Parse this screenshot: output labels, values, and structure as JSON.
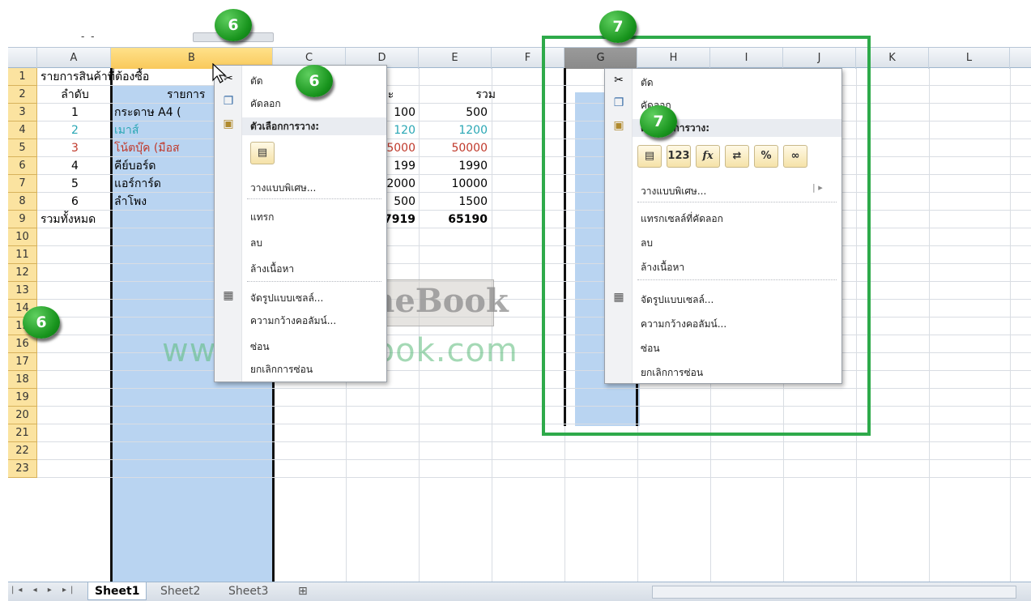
{
  "formula_bar": {
    "name_box_fragment": "- -"
  },
  "columns": [
    "A",
    "B",
    "C",
    "D",
    "E",
    "F",
    "G",
    "H",
    "I",
    "J",
    "K",
    "L"
  ],
  "rows": [
    "1",
    "2",
    "3",
    "4",
    "5",
    "6",
    "7",
    "8",
    "9",
    "10",
    "11",
    "12",
    "13",
    "14",
    "15",
    "16",
    "17",
    "18",
    "19",
    "20",
    "21",
    "22",
    "23"
  ],
  "cells": {
    "title": "รายการสินค้าที่ต้องซื้อ",
    "hdr_no": "ลำดับ",
    "hdr_item": "รายการ",
    "hdr_price": "ยละ",
    "hdr_total": "รวม",
    "r3": {
      "no": "1",
      "item": "กระดาษ   A4 (",
      "price": "100",
      "total": "500"
    },
    "r4": {
      "no": "2",
      "item": "เมาส์",
      "price": "120",
      "total": "1200"
    },
    "r5": {
      "no": "3",
      "item": "โน้ตบุ๊ค  (มือส",
      "price": "5000",
      "total": "50000"
    },
    "r6": {
      "no": "4",
      "item": "คีย์บอร์ด",
      "price": "199",
      "total": "1990"
    },
    "r7": {
      "no": "5",
      "item": "แอร์การ์ด",
      "price": "2000",
      "total": "10000"
    },
    "r8": {
      "no": "6",
      "item": "ลำโพง",
      "price": "500",
      "total": "1500"
    },
    "r9": {
      "label": "รวมทั้งหมด",
      "price": "7919",
      "total": "65190"
    }
  },
  "menu1": {
    "cut": "ตัด",
    "copy": "คัดลอก",
    "paste_options": "ตัวเลือกการวาง:",
    "paste_special": "วางแบบพิเศษ...",
    "insert": "แทรก",
    "delete": "ลบ",
    "clear": "ล้างเนื้อหา",
    "format_cells": "จัดรูปแบบเซลล์...",
    "column_width": "ความกว้างคอลัมน์...",
    "hide": "ซ่อน",
    "unhide": "ยกเลิกการซ่อน"
  },
  "menu2": {
    "cut": "ตัด",
    "copy": "คัดลอก",
    "paste_options": "ตัวเลือกการวาง:",
    "paste_btn_values": "123",
    "paste_btn_formula": "fx",
    "paste_btn_percent": "%",
    "paste_special": "วางแบบพิเศษ...",
    "insert_copied": "แทรกเซลล์ที่คัดลอก",
    "delete": "ลบ",
    "clear": "ล้างเนื้อหา",
    "format_cells": "จัดรูปแบบเซลล์...",
    "column_width": "ความกว้างคอลัมน์...",
    "hide": "ซ่อน",
    "unhide": "ยกเลิกการซ่อน"
  },
  "badges": {
    "b1": "6",
    "b2": "6",
    "b3": "6",
    "b4": "7",
    "b5": "7"
  },
  "watermark": {
    "url": "www.siamebook.com",
    "logo": "SiameBook"
  },
  "sheet_tabs": [
    "Sheet1",
    "Sheet2",
    "Sheet3"
  ],
  "colors": {
    "accent_green": "#2eaa4a",
    "selection": "#b9d4f1",
    "row_header": "#fbe3a0",
    "teal_text": "#2aa7b5",
    "red_text": "#c0392b"
  }
}
